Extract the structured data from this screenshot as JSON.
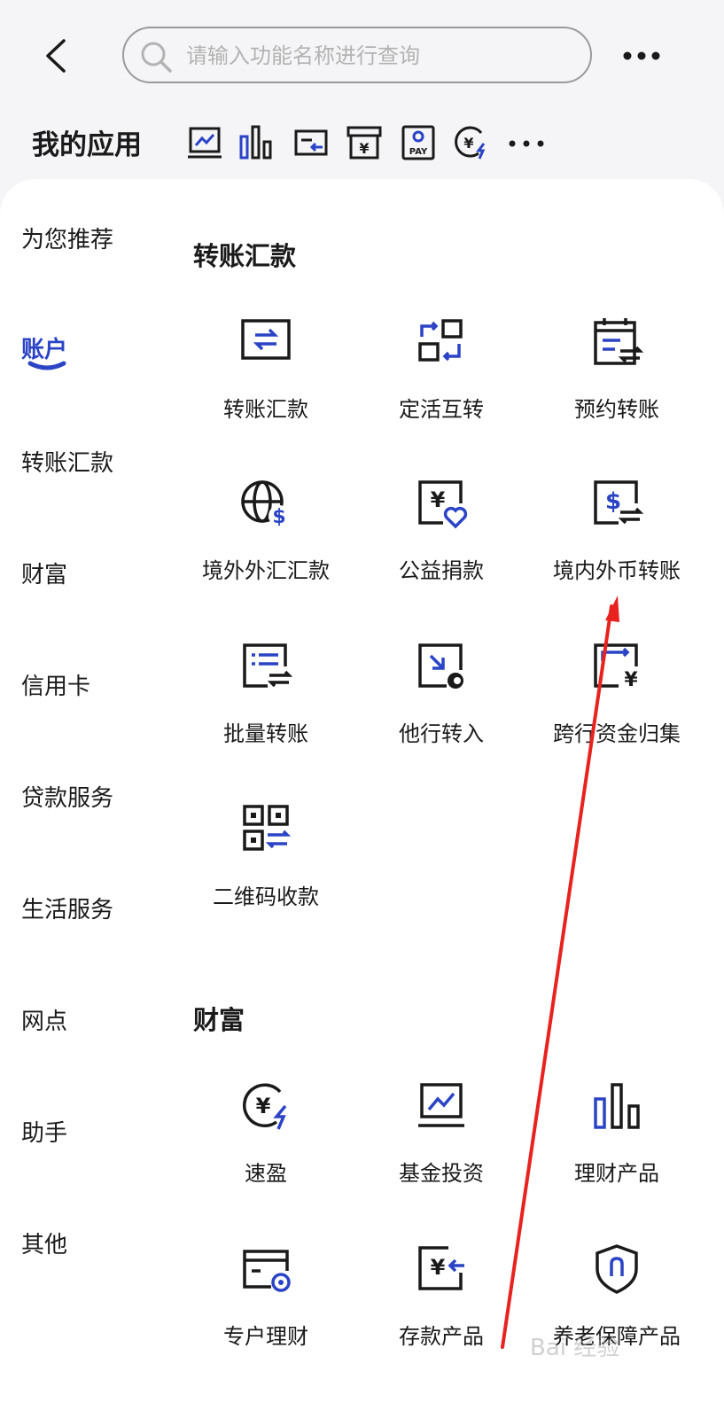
{
  "search": {
    "placeholder": "请输入功能名称进行查询",
    "value": ""
  },
  "my_apps": {
    "title": "我的应用",
    "icons": [
      "fund-chart-icon",
      "bar-chart-icon",
      "transfer-card-icon",
      "yen-box-icon",
      "pay-icon",
      "yen-speed-icon"
    ]
  },
  "sidebar": {
    "items": [
      {
        "label": "为您推荐"
      },
      {
        "label": "账户",
        "active": true
      },
      {
        "label": "转账汇款"
      },
      {
        "label": "财富"
      },
      {
        "label": "信用卡"
      },
      {
        "label": "贷款服务"
      },
      {
        "label": "生活服务"
      },
      {
        "label": "网点"
      },
      {
        "label": "助手"
      },
      {
        "label": "其他"
      }
    ]
  },
  "sections": {
    "transfer": {
      "title": "转账汇款",
      "items": [
        {
          "label": "转账汇款",
          "icon": "transfer-icon"
        },
        {
          "label": "定活互转",
          "icon": "fixed-current-swap-icon"
        },
        {
          "label": "预约转账",
          "icon": "scheduled-transfer-icon"
        },
        {
          "label": "境外外汇汇款",
          "icon": "globe-dollar-icon"
        },
        {
          "label": "公益捐款",
          "icon": "charity-icon"
        },
        {
          "label": "境内外币转账",
          "icon": "foreign-currency-transfer-icon"
        },
        {
          "label": "批量转账",
          "icon": "batch-transfer-icon"
        },
        {
          "label": "他行转入",
          "icon": "other-bank-in-icon"
        },
        {
          "label": "跨行资金归集",
          "icon": "fund-collection-icon"
        },
        {
          "label": "二维码收款",
          "icon": "qr-code-icon"
        }
      ]
    },
    "wealth": {
      "title": "财富",
      "items": [
        {
          "label": "速盈",
          "icon": "yen-speed-icon"
        },
        {
          "label": "基金投资",
          "icon": "fund-chart-icon"
        },
        {
          "label": "理财产品",
          "icon": "bar-chart-icon"
        },
        {
          "label": "专户理财",
          "icon": "card-coin-icon"
        },
        {
          "label": "存款产品",
          "icon": "deposit-icon"
        },
        {
          "label": "养老保障产品",
          "icon": "shield-icon"
        }
      ]
    }
  },
  "watermark": "Bai 经验",
  "colors": {
    "accent": "#2b44c6",
    "annotation": "#e8231f"
  }
}
